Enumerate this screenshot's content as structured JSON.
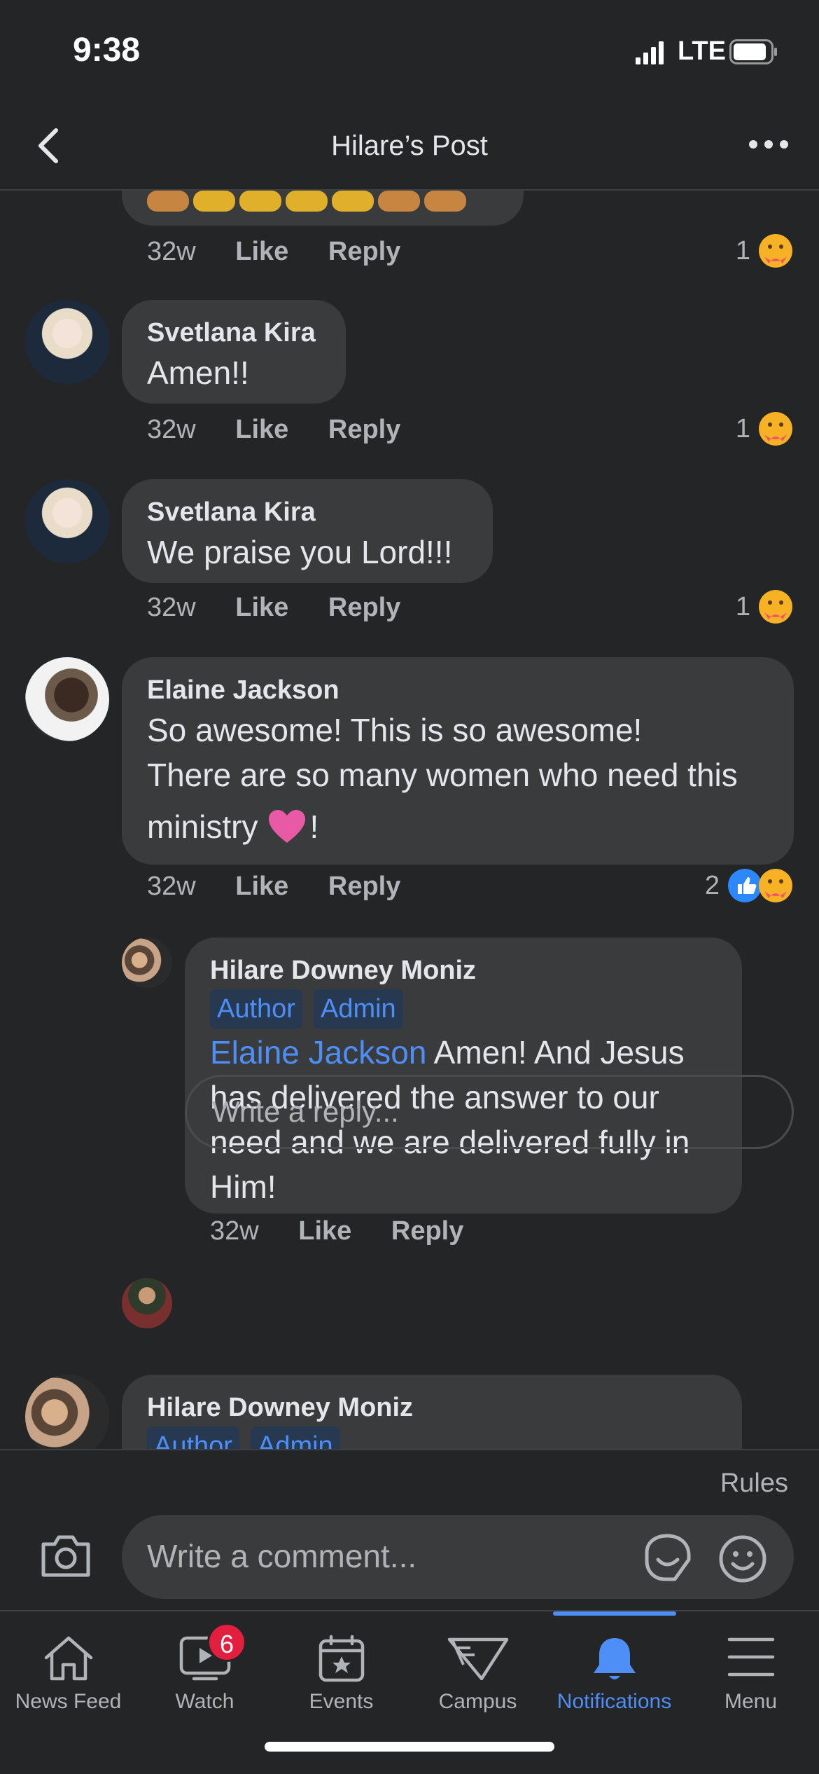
{
  "status_bar": {
    "time": "9:38",
    "network": "LTE"
  },
  "header": {
    "title": "Hilare’s Post"
  },
  "partial_comment": {
    "time": "32w",
    "like": "Like",
    "reply": "Reply",
    "reaction_count": "1"
  },
  "comments": [
    {
      "author": "Svetlana Kira",
      "text": "Amen!!",
      "time": "32w",
      "like": "Like",
      "reply": "Reply",
      "reaction_count": "1"
    },
    {
      "author": "Svetlana Kira",
      "text": "We praise you Lord!!!",
      "time": "32w",
      "like": "Like",
      "reply": "Reply",
      "reaction_count": "1"
    },
    {
      "author": "Elaine Jackson",
      "text_line1": "So awesome! This is so awesome!",
      "text_line2": "There are so many women who need this",
      "text_line3": "ministry",
      "text_suffix": "!",
      "time": "32w",
      "like": "Like",
      "reply": "Reply",
      "reaction_count": "2"
    }
  ],
  "reply": {
    "author": "Hilare Downey Moniz",
    "badges": [
      "Author",
      "Admin"
    ],
    "mention": "Elaine Jackson",
    "text_line1": " Amen! And Jesus",
    "text_line2": "has delivered the answer to our",
    "text_line3": "need and we are delivered fully in",
    "text_line4": "Him!",
    "time": "32w",
    "like": "Like",
    "reply": "Reply"
  },
  "reply_input": {
    "placeholder": "Write a reply..."
  },
  "next_comment": {
    "author": "Hilare Downey Moniz",
    "badges": [
      "Author",
      "Admin"
    ]
  },
  "composer": {
    "rules": "Rules",
    "placeholder": "Write a comment..."
  },
  "tabs": [
    {
      "label": "News Feed",
      "icon": "home-icon"
    },
    {
      "label": "Watch",
      "icon": "watch-icon",
      "badge": "6"
    },
    {
      "label": "Events",
      "icon": "events-icon"
    },
    {
      "label": "Campus",
      "icon": "campus-icon"
    },
    {
      "label": "Notifications",
      "icon": "bell-icon",
      "active": true
    },
    {
      "label": "Menu",
      "icon": "menu-icon"
    }
  ],
  "colors": {
    "background": "#242526",
    "bubble": "#3a3b3c",
    "accent": "#4e8ef7",
    "badge_red": "#e41e3f"
  }
}
